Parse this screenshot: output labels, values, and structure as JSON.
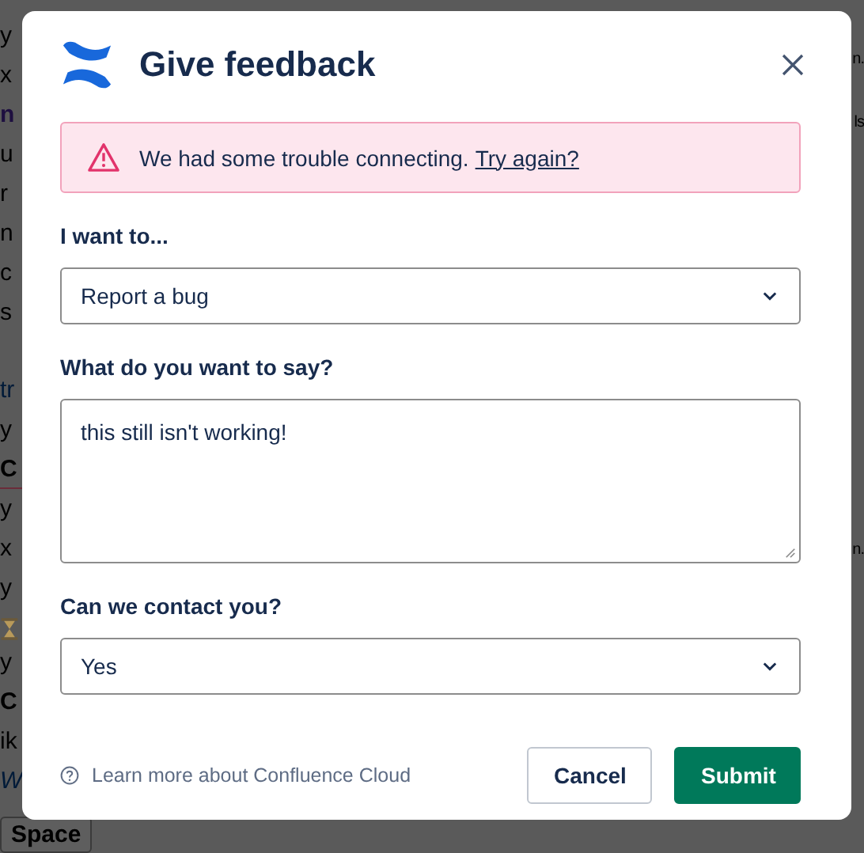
{
  "backdrop": {
    "left_lines": [
      {
        "kind": "text",
        "text": "y"
      },
      {
        "kind": "text",
        "text": "x"
      },
      {
        "kind": "name",
        "text": "n"
      },
      {
        "kind": "text",
        "text": "u"
      },
      {
        "kind": "text",
        "text": "r"
      },
      {
        "kind": "text",
        "text": "n"
      },
      {
        "kind": "text",
        "text": "c"
      },
      {
        "kind": "text",
        "text": "s"
      },
      {
        "kind": "gap"
      },
      {
        "kind": "link",
        "text": "tr"
      },
      {
        "kind": "text",
        "text": "y"
      },
      {
        "kind": "bold",
        "text": "C"
      },
      {
        "kind": "divider"
      },
      {
        "kind": "text",
        "text": "y"
      },
      {
        "kind": "text",
        "text": "x"
      },
      {
        "kind": "text",
        "text": "y"
      },
      {
        "kind": "hourglass"
      },
      {
        "kind": "text",
        "text": "y"
      },
      {
        "kind": "bold",
        "text": "C"
      },
      {
        "kind": "text",
        "text": "ik"
      },
      {
        "kind": "italic-link",
        "text": "W"
      },
      {
        "kind": "button",
        "text": "Space"
      }
    ],
    "right_lines": [
      {
        "kind": "text",
        "text": "n."
      },
      {
        "kind": "text",
        "text": "ls"
      },
      {
        "kind": "text",
        "text": "n."
      }
    ]
  },
  "dialog": {
    "title": "Give feedback",
    "alert": {
      "message": "We had some trouble connecting.",
      "link": "Try again?"
    },
    "fields": [
      {
        "kind": "select",
        "label": "I want to...",
        "value": "Report a bug"
      },
      {
        "kind": "textarea",
        "label": "What do you want to say?",
        "value": "this still isn't working!"
      },
      {
        "kind": "select",
        "label": "Can we contact you?",
        "value": "Yes"
      }
    ],
    "help_link": "Learn more about Confluence Cloud",
    "buttons": [
      {
        "kind": "secondary",
        "label": "Cancel"
      },
      {
        "kind": "primary",
        "label": "Submit"
      }
    ]
  }
}
